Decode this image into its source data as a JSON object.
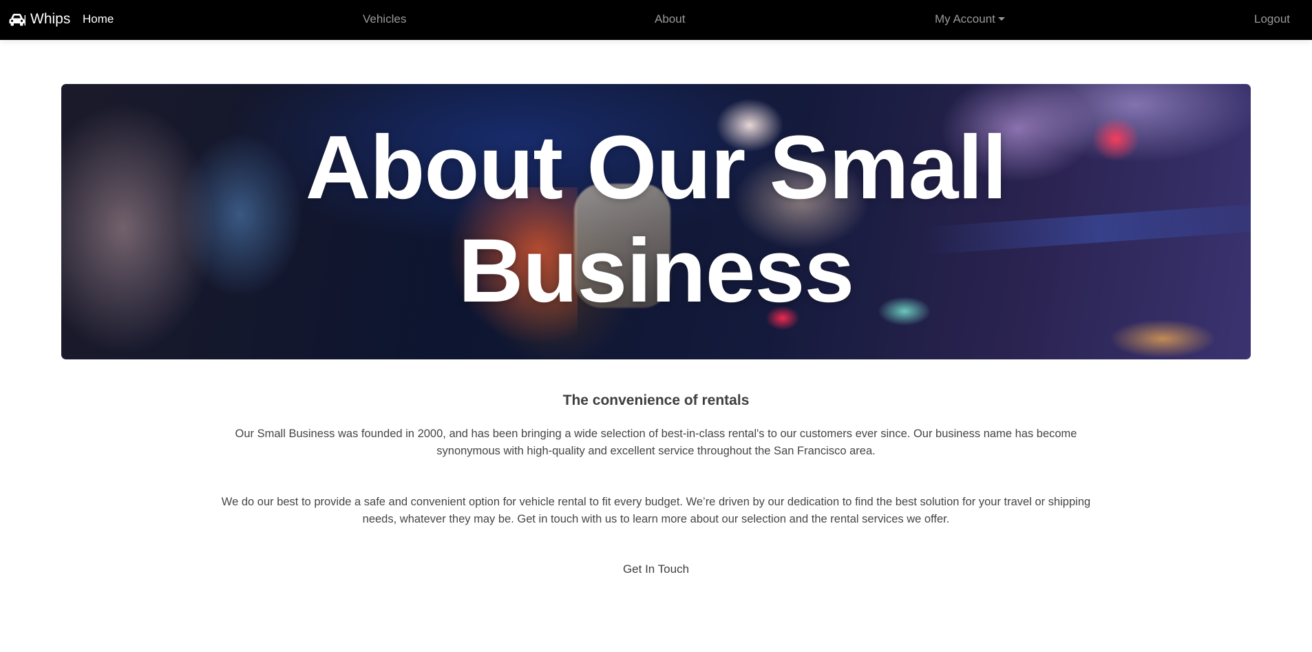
{
  "navbar": {
    "brand": "Whips",
    "brand_icon": "car-icon",
    "links": {
      "home": "Home",
      "vehicles": "Vehicles",
      "about": "About",
      "account": "My Account",
      "logout": "Logout"
    }
  },
  "hero": {
    "title_line1": "About Our Small",
    "title_line2": "Business"
  },
  "content": {
    "subtitle": "The convenience of rentals",
    "paragraph1_line1": "Our Small Business was founded in 2000, and has been bringing a wide selection of best-in-class rental's to our customers ever since. Our business name has become",
    "paragraph1_line2": "synonymous with high-quality and excellent service throughout the San Francisco area.",
    "paragraph2_line1": "We do our best to provide a safe and convenient option for vehicle rental to fit every budget. We’re driven by our dedication to find the best solution for your travel or shipping",
    "paragraph2_line2": "needs, whatever they may be. Get in touch with us to learn more about our selection and the rental services we offer.",
    "cta": "Get In Touch"
  },
  "colors": {
    "navbar_bg": "#000000",
    "nav_active": "#ffffff",
    "nav_inactive": "#9a9a9a"
  }
}
